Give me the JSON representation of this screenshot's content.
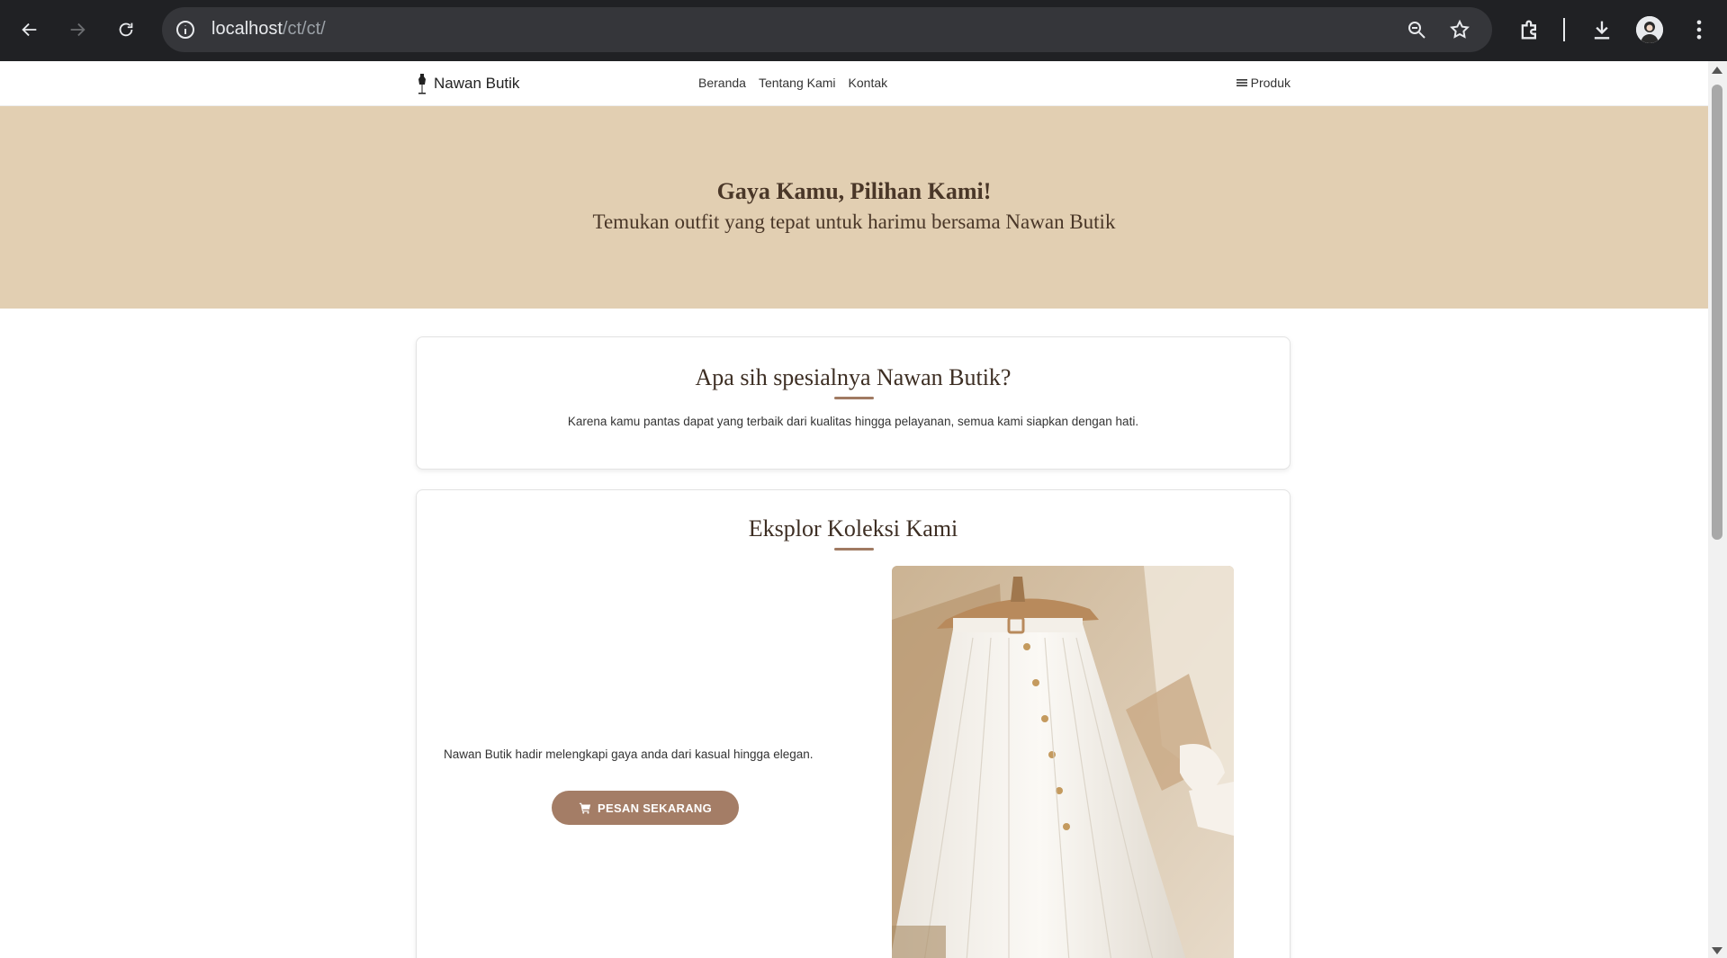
{
  "browser": {
    "url_host": "localhost",
    "url_path": "/ct/ct/",
    "icons": [
      "back-arrow-icon",
      "forward-arrow-icon",
      "reload-icon",
      "info-icon",
      "zoom-icon",
      "star-icon",
      "extensions-icon",
      "download-icon",
      "profile-avatar",
      "more-menu-icon"
    ]
  },
  "nav": {
    "brand": "Nawan Butik",
    "links": [
      "Beranda",
      "Tentang Kami",
      "Kontak"
    ],
    "produk": "Produk"
  },
  "hero": {
    "title": "Gaya Kamu, Pilihan Kami!",
    "subtitle": "Temukan outfit yang tepat untuk harimu bersama Nawan Butik"
  },
  "special": {
    "title": "Apa sih spesialnya Nawan Butik?",
    "text": "Karena kamu pantas dapat yang terbaik dari kualitas hingga pelayanan, semua kami siapkan dengan hati."
  },
  "collection": {
    "title": "Eksplor Koleksi Kami",
    "description": "Nawan Butik hadir melengkapi gaya anda dari kasual hingga elegan.",
    "button": "PESAN SEKARANG"
  },
  "colors": {
    "hero_bg": "#e2cfb2",
    "accent": "#a47d66",
    "text_dark": "#4a3728",
    "chrome_bg": "#202124"
  }
}
